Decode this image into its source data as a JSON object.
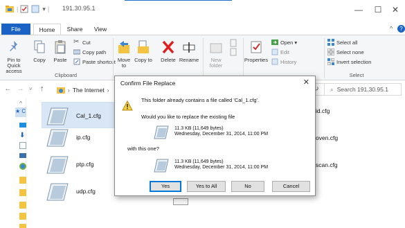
{
  "window": {
    "title": "191.30.95.1",
    "minimize_glyph": "—",
    "maximize_glyph": "☐",
    "close_glyph": "✕"
  },
  "ribbon_tabs": {
    "file": "File",
    "home": "Home",
    "share": "Share",
    "view": "View"
  },
  "ribbon": {
    "clipboard": {
      "pin_label": "Pin to Quick access",
      "copy_label": "Copy",
      "paste_label": "Paste",
      "cut_label": "Cut",
      "copy_path_label": "Copy path",
      "paste_shortcut_label": "Paste shortcut",
      "group_label": "Clipboard"
    },
    "organize": {
      "move_label": "Move to",
      "copy_to_label": "Copy to",
      "delete_label": "Delete",
      "rename_label": "Rename"
    },
    "new": {
      "new_folder_label": "New folder"
    },
    "open": {
      "properties_label": "Properties",
      "open_label": "Open",
      "edit_label": "Edit",
      "history_label": "History"
    },
    "select": {
      "select_all_label": "Select all",
      "select_none_label": "Select none",
      "invert_label": "Invert selection",
      "group_label": "Select"
    }
  },
  "address": {
    "crumb": "The Internet",
    "search_placeholder": "Search 191.30.95.1"
  },
  "files": [
    {
      "name": "Cal_1.cfg"
    },
    {
      "name": "ip.cfg"
    },
    {
      "name": "ptp.cfg"
    },
    {
      "name": "udp.cfg"
    }
  ],
  "files_right": [
    {
      "name": "id.cfg"
    },
    {
      "name": "oven.cfg"
    },
    {
      "name": "scan.cfg"
    }
  ],
  "dialog": {
    "title": "Confirm File Replace",
    "message": "This folder already contains a file called 'Cal_1.cfg'.",
    "question": "Would you like to replace the existing file",
    "existing_size": "11.3 KB (11,649 bytes)",
    "existing_date": "Wednesday, December 31, 2014, 11:00 PM",
    "with_label": "with this one?",
    "new_size": "11.3 KB (11,649 bytes)",
    "new_date": "Wednesday, December 31, 2014, 11:00 PM",
    "btn_yes": "Yes",
    "btn_yes_all": "Yes to All",
    "btn_no": "No",
    "btn_cancel": "Cancel"
  },
  "colors": {
    "accent": "#1a63c4",
    "delete_red": "#e02020"
  }
}
